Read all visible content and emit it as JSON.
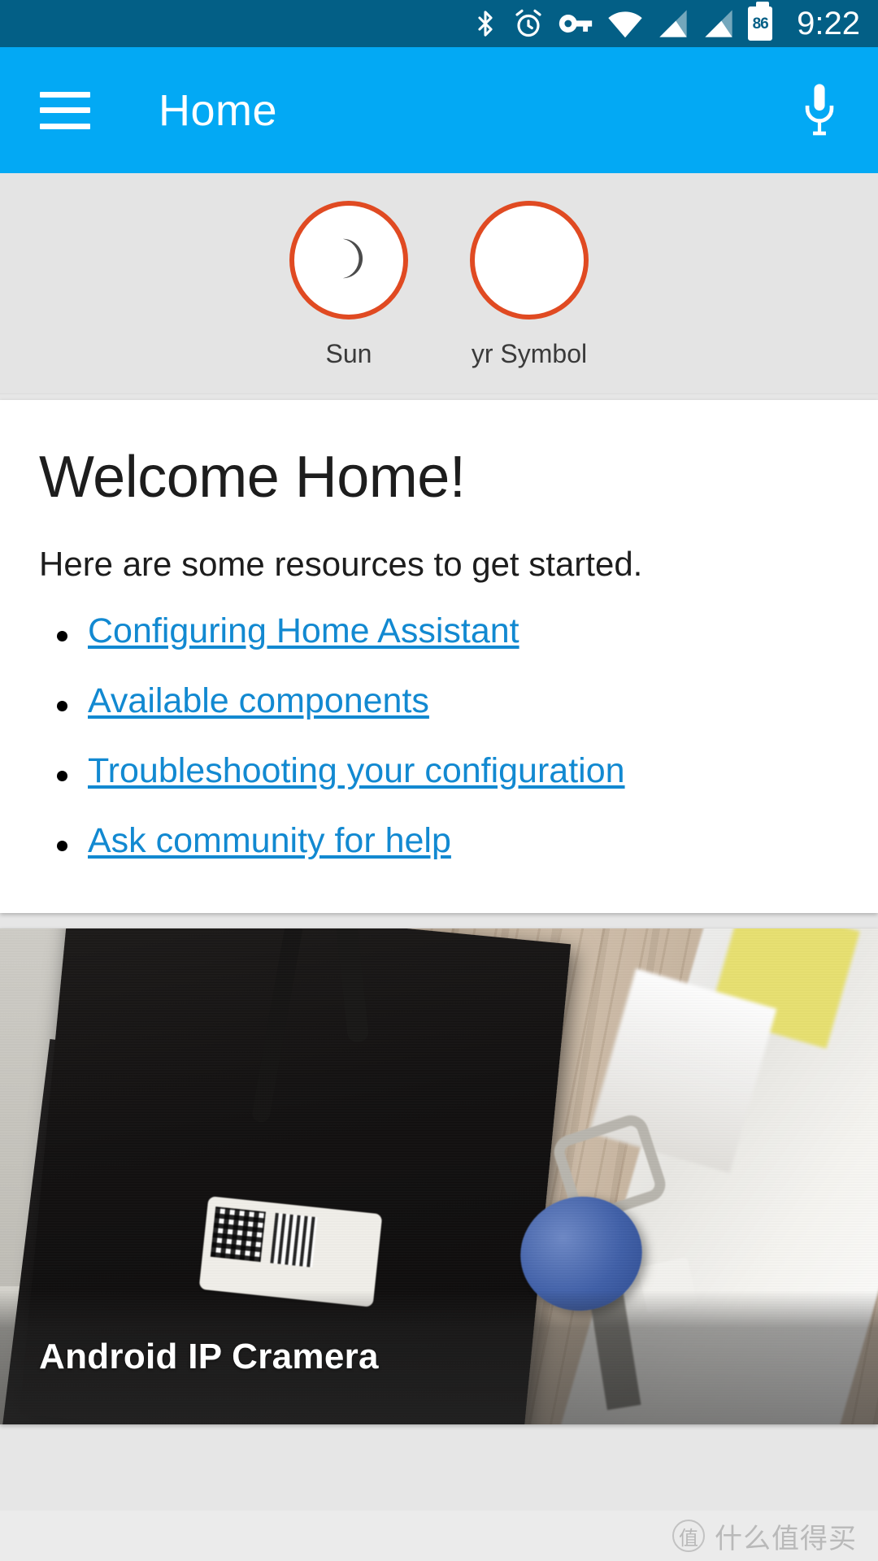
{
  "status_bar": {
    "background_color": "#035f86",
    "time": "9:22",
    "battery_level": "86",
    "icons": [
      {
        "name": "bluetooth-icon",
        "label": "Bluetooth"
      },
      {
        "name": "alarm-clock-icon",
        "label": "Alarm"
      },
      {
        "name": "vpn-key-icon",
        "label": "VPN key"
      },
      {
        "name": "wifi-icon",
        "label": "Wi-Fi"
      },
      {
        "name": "signal-bars-sim1-icon",
        "label": "Signal SIM 1"
      },
      {
        "name": "signal-bars-sim2-icon",
        "label": "Signal SIM 2"
      },
      {
        "name": "battery-icon",
        "label": "Battery"
      }
    ]
  },
  "app_bar": {
    "background_color": "#03a9f4",
    "menu_icon": "hamburger-menu-icon",
    "title": "Home",
    "action_icon": "microphone-icon"
  },
  "badges": {
    "background_color": "#e4e4e4",
    "border_color": "#e04a22",
    "items": [
      {
        "label": "Sun",
        "icon": "crescent-moon-icon",
        "has_icon": true
      },
      {
        "label": "yr Symbol",
        "icon": "blank-icon",
        "has_icon": false
      }
    ]
  },
  "welcome_card": {
    "title": "Welcome Home!",
    "subtitle": "Here are some resources to get started.",
    "link_color": "#1289d1",
    "links": [
      "Configuring Home Assistant",
      "Available components",
      "Troubleshooting your configuration",
      "Ask community for help"
    ]
  },
  "camera_card": {
    "caption": "Android IP Cramera",
    "scene_description": "Blurry indoor photo of a black set-top box with QR code stickers on a wooden desk, keys with a blue round keyfob beside it"
  },
  "watermark": {
    "logo_glyph": "值",
    "text": "什么值得买"
  }
}
